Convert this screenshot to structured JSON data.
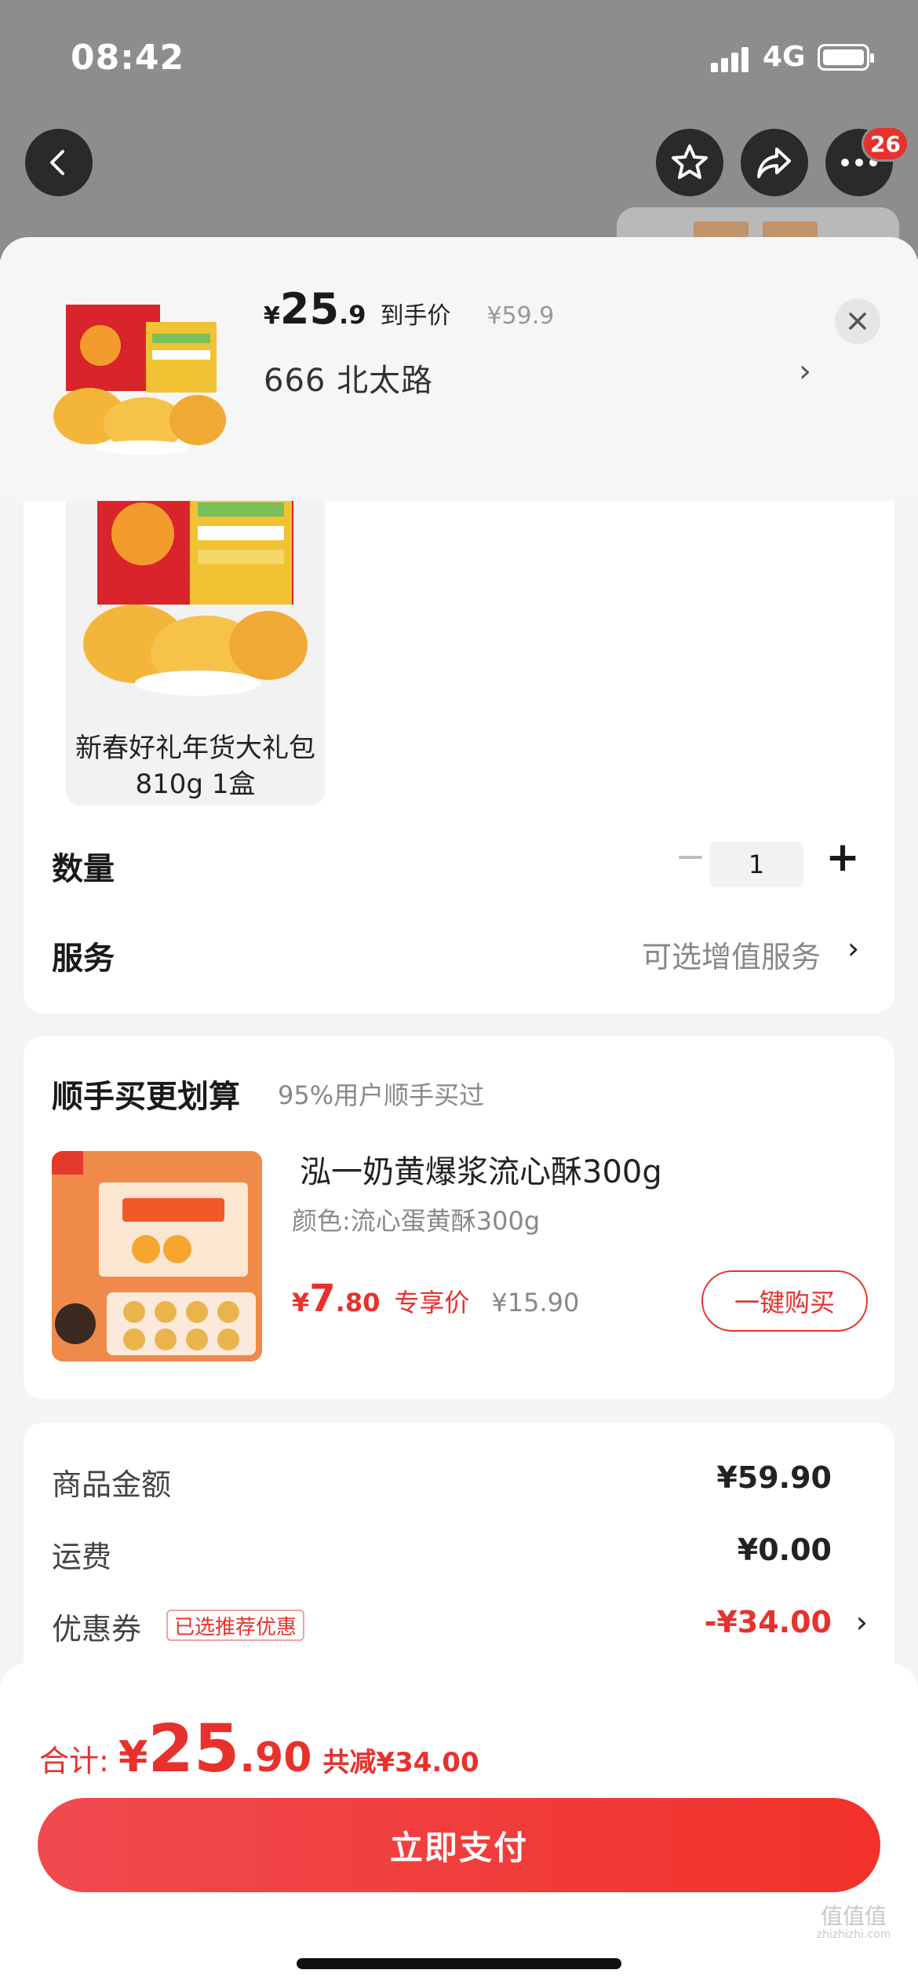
{
  "status_bar": {
    "time": "08:42",
    "network": "4G"
  },
  "nav": {
    "badge_count": "26"
  },
  "header": {
    "price_symbol": "¥",
    "price_int": "25",
    "price_dec": ".9",
    "price_label": "到手价",
    "original_price": "¥59.9",
    "address": "666  北太路",
    "chevron": "›"
  },
  "variant": {
    "label": "新春好礼年货大礼包 810g 1盒"
  },
  "quantity": {
    "label": "数量",
    "value": "1",
    "plus": "+"
  },
  "service": {
    "label": "服务",
    "value": "可选增值服务",
    "chevron": "›"
  },
  "addon": {
    "title": "顺手买更划算",
    "subtitle": "95%用户顺手买过",
    "name": "泓一奶黄爆浆流心酥300g",
    "spec": "颜色:流心蛋黄酥300g",
    "price_symbol": "¥",
    "price_int": "7",
    "price_dec": ".80",
    "price_tag": "专享价",
    "original_price": "¥15.90",
    "buy_label": "一键购买"
  },
  "summary": {
    "goods_label": "商品金额",
    "goods_value": "¥59.90",
    "shipping_label": "运费",
    "shipping_value": "¥0.00",
    "coupon_label": "优惠券",
    "coupon_tag": "已选推荐优惠",
    "coupon_value": "-¥34.00",
    "chevron": "›"
  },
  "footer": {
    "total_label": "合计:",
    "total_symbol": "¥",
    "total_int": "25",
    "total_dec": ".90",
    "total_save": "共减¥34.00",
    "pay_label": "立即支付"
  },
  "watermark": {
    "brand": "值值值",
    "domain": "zhizhizhi.com"
  },
  "colors": {
    "accent": "#e8312c",
    "backdrop": "#8d8d8d",
    "page_bg": "#f4f4f4"
  }
}
